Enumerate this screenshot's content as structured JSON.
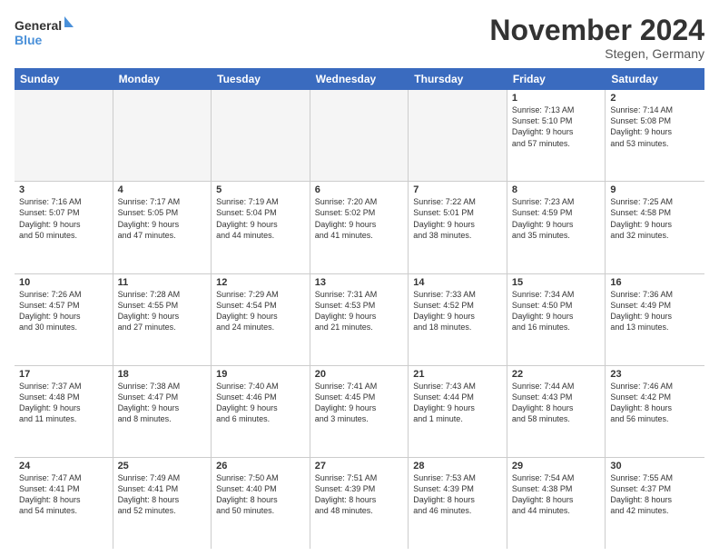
{
  "logo": {
    "line1": "General",
    "line2": "Blue"
  },
  "title": "November 2024",
  "location": "Stegen, Germany",
  "days_of_week": [
    "Sunday",
    "Monday",
    "Tuesday",
    "Wednesday",
    "Thursday",
    "Friday",
    "Saturday"
  ],
  "weeks": [
    [
      {
        "day": "",
        "info": "",
        "empty": true
      },
      {
        "day": "",
        "info": "",
        "empty": true
      },
      {
        "day": "",
        "info": "",
        "empty": true
      },
      {
        "day": "",
        "info": "",
        "empty": true
      },
      {
        "day": "",
        "info": "",
        "empty": true
      },
      {
        "day": "1",
        "info": "Sunrise: 7:13 AM\nSunset: 5:10 PM\nDaylight: 9 hours\nand 57 minutes."
      },
      {
        "day": "2",
        "info": "Sunrise: 7:14 AM\nSunset: 5:08 PM\nDaylight: 9 hours\nand 53 minutes."
      }
    ],
    [
      {
        "day": "3",
        "info": "Sunrise: 7:16 AM\nSunset: 5:07 PM\nDaylight: 9 hours\nand 50 minutes."
      },
      {
        "day": "4",
        "info": "Sunrise: 7:17 AM\nSunset: 5:05 PM\nDaylight: 9 hours\nand 47 minutes."
      },
      {
        "day": "5",
        "info": "Sunrise: 7:19 AM\nSunset: 5:04 PM\nDaylight: 9 hours\nand 44 minutes."
      },
      {
        "day": "6",
        "info": "Sunrise: 7:20 AM\nSunset: 5:02 PM\nDaylight: 9 hours\nand 41 minutes."
      },
      {
        "day": "7",
        "info": "Sunrise: 7:22 AM\nSunset: 5:01 PM\nDaylight: 9 hours\nand 38 minutes."
      },
      {
        "day": "8",
        "info": "Sunrise: 7:23 AM\nSunset: 4:59 PM\nDaylight: 9 hours\nand 35 minutes."
      },
      {
        "day": "9",
        "info": "Sunrise: 7:25 AM\nSunset: 4:58 PM\nDaylight: 9 hours\nand 32 minutes."
      }
    ],
    [
      {
        "day": "10",
        "info": "Sunrise: 7:26 AM\nSunset: 4:57 PM\nDaylight: 9 hours\nand 30 minutes."
      },
      {
        "day": "11",
        "info": "Sunrise: 7:28 AM\nSunset: 4:55 PM\nDaylight: 9 hours\nand 27 minutes."
      },
      {
        "day": "12",
        "info": "Sunrise: 7:29 AM\nSunset: 4:54 PM\nDaylight: 9 hours\nand 24 minutes."
      },
      {
        "day": "13",
        "info": "Sunrise: 7:31 AM\nSunset: 4:53 PM\nDaylight: 9 hours\nand 21 minutes."
      },
      {
        "day": "14",
        "info": "Sunrise: 7:33 AM\nSunset: 4:52 PM\nDaylight: 9 hours\nand 18 minutes."
      },
      {
        "day": "15",
        "info": "Sunrise: 7:34 AM\nSunset: 4:50 PM\nDaylight: 9 hours\nand 16 minutes."
      },
      {
        "day": "16",
        "info": "Sunrise: 7:36 AM\nSunset: 4:49 PM\nDaylight: 9 hours\nand 13 minutes."
      }
    ],
    [
      {
        "day": "17",
        "info": "Sunrise: 7:37 AM\nSunset: 4:48 PM\nDaylight: 9 hours\nand 11 minutes."
      },
      {
        "day": "18",
        "info": "Sunrise: 7:38 AM\nSunset: 4:47 PM\nDaylight: 9 hours\nand 8 minutes."
      },
      {
        "day": "19",
        "info": "Sunrise: 7:40 AM\nSunset: 4:46 PM\nDaylight: 9 hours\nand 6 minutes."
      },
      {
        "day": "20",
        "info": "Sunrise: 7:41 AM\nSunset: 4:45 PM\nDaylight: 9 hours\nand 3 minutes."
      },
      {
        "day": "21",
        "info": "Sunrise: 7:43 AM\nSunset: 4:44 PM\nDaylight: 9 hours\nand 1 minute."
      },
      {
        "day": "22",
        "info": "Sunrise: 7:44 AM\nSunset: 4:43 PM\nDaylight: 8 hours\nand 58 minutes."
      },
      {
        "day": "23",
        "info": "Sunrise: 7:46 AM\nSunset: 4:42 PM\nDaylight: 8 hours\nand 56 minutes."
      }
    ],
    [
      {
        "day": "24",
        "info": "Sunrise: 7:47 AM\nSunset: 4:41 PM\nDaylight: 8 hours\nand 54 minutes."
      },
      {
        "day": "25",
        "info": "Sunrise: 7:49 AM\nSunset: 4:41 PM\nDaylight: 8 hours\nand 52 minutes."
      },
      {
        "day": "26",
        "info": "Sunrise: 7:50 AM\nSunset: 4:40 PM\nDaylight: 8 hours\nand 50 minutes."
      },
      {
        "day": "27",
        "info": "Sunrise: 7:51 AM\nSunset: 4:39 PM\nDaylight: 8 hours\nand 48 minutes."
      },
      {
        "day": "28",
        "info": "Sunrise: 7:53 AM\nSunset: 4:39 PM\nDaylight: 8 hours\nand 46 minutes."
      },
      {
        "day": "29",
        "info": "Sunrise: 7:54 AM\nSunset: 4:38 PM\nDaylight: 8 hours\nand 44 minutes."
      },
      {
        "day": "30",
        "info": "Sunrise: 7:55 AM\nSunset: 4:37 PM\nDaylight: 8 hours\nand 42 minutes."
      }
    ]
  ]
}
